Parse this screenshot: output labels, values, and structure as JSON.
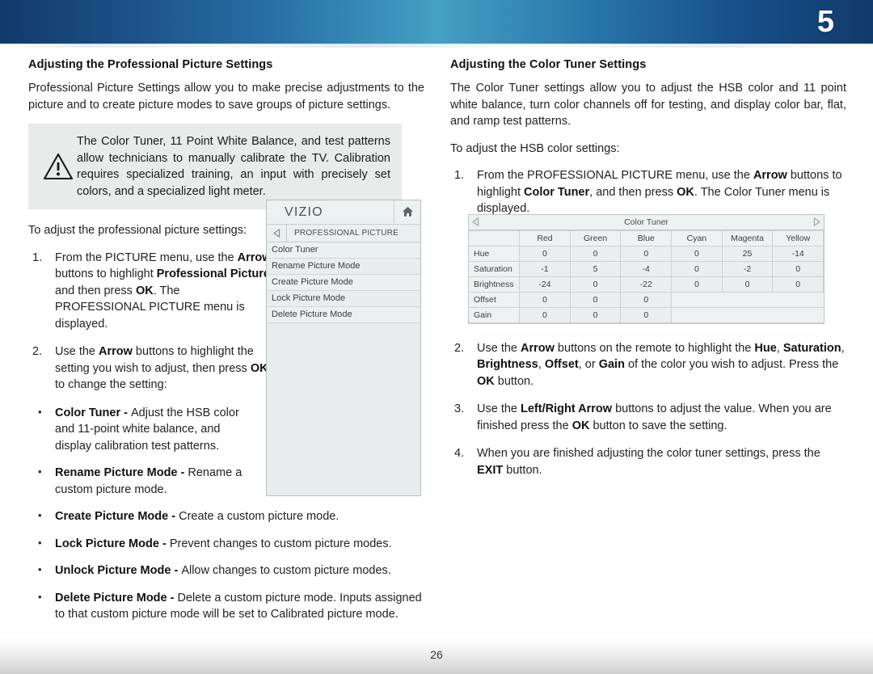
{
  "header": {
    "chapter_number": "5",
    "gradient_center": "#44a0c4",
    "gradient_edge": "#123a6b"
  },
  "footer": {
    "page_number": "26"
  },
  "left_column": {
    "section_title": "Adjusting the Professional Picture Settings",
    "intro": "Professional Picture Settings allow you to make precise adjustments to the picture and to create picture modes to save groups of picture settings.",
    "note": {
      "icon": "warning-triangle-icon",
      "text": "The Color Tuner, 11 Point White Balance, and test patterns allow technicians to manually calibrate the TV. Calibration requires specialized training, an input with precisely set colors, and a specialized light meter."
    },
    "lead_in": "To adjust the professional picture settings:",
    "steps": [
      {
        "number": "1.",
        "parts": [
          {
            "t": "From the PICTURE menu, use the ",
            "b": false
          },
          {
            "t": "Arrow",
            "b": true
          },
          {
            "t": " buttons to highlight ",
            "b": false
          },
          {
            "t": "Professional Picture",
            "b": true
          },
          {
            "t": ", and then press ",
            "b": false
          },
          {
            "t": "OK",
            "b": true
          },
          {
            "t": ". The PROFESSIONAL PICTURE menu is displayed.",
            "b": false
          }
        ]
      },
      {
        "number": "2.",
        "parts": [
          {
            "t": "Use the ",
            "b": false
          },
          {
            "t": "Arrow",
            "b": true
          },
          {
            "t": " buttons to highlight the setting you wish to adjust, then press ",
            "b": false
          },
          {
            "t": "OK",
            "b": true
          },
          {
            "t": " to change the setting:",
            "b": false
          }
        ]
      }
    ],
    "bullets": [
      {
        "narrow": true,
        "parts": [
          {
            "t": "Color Tuner - ",
            "b": true
          },
          {
            "t": "Adjust the HSB color and 11-point white balance, and display calibration test patterns.",
            "b": false
          }
        ]
      },
      {
        "narrow": true,
        "parts": [
          {
            "t": "Rename Picture Mode - ",
            "b": true
          },
          {
            "t": "Rename a custom picture mode.",
            "b": false
          }
        ]
      },
      {
        "narrow": false,
        "parts": [
          {
            "t": "Create Picture Mode - ",
            "b": true
          },
          {
            "t": "Create a custom picture mode.",
            "b": false
          }
        ]
      },
      {
        "narrow": false,
        "parts": [
          {
            "t": "Lock Picture Mode - ",
            "b": true
          },
          {
            "t": "Prevent changes to custom picture modes.",
            "b": false
          }
        ]
      },
      {
        "narrow": false,
        "parts": [
          {
            "t": "Unlock Picture Mode - ",
            "b": true
          },
          {
            "t": "Allow changes to custom picture modes.",
            "b": false
          }
        ]
      },
      {
        "narrow": false,
        "parts": [
          {
            "t": "Delete Picture Mode - ",
            "b": true
          },
          {
            "t": "Delete a custom picture mode. Inputs assigned to that custom picture mode will be set to Calibrated picture mode.",
            "b": false
          }
        ]
      }
    ]
  },
  "tv_menu": {
    "brand": "VIZIO",
    "home_icon": "home-icon",
    "back_icon": "back-arrow-icon",
    "breadcrumb": "PROFESSIONAL PICTURE",
    "items": [
      "Color Tuner",
      "Rename Picture Mode",
      "Create Picture Mode",
      "Lock Picture Mode",
      "Delete Picture Mode"
    ]
  },
  "right_column": {
    "section_title": "Adjusting the Color Tuner Settings",
    "intro": "The Color Tuner settings allow you to adjust the HSB color and 11 point white balance, turn color channels off for testing, and display color bar, flat, and ramp test patterns.",
    "lead_in": "To adjust the HSB color settings:",
    "steps": [
      {
        "number": "1.",
        "parts": [
          {
            "t": "From the PROFESSIONAL PICTURE menu, use the ",
            "b": false
          },
          {
            "t": "Arrow",
            "b": true
          },
          {
            "t": " buttons to highlight ",
            "b": false
          },
          {
            "t": "Color Tuner",
            "b": true
          },
          {
            "t": ", and then press ",
            "b": false
          },
          {
            "t": "OK",
            "b": true
          },
          {
            "t": ". The Color Tuner menu is displayed.",
            "b": false
          }
        ]
      },
      {
        "number": "2.",
        "parts": [
          {
            "t": "Use the ",
            "b": false
          },
          {
            "t": "Arrow",
            "b": true
          },
          {
            "t": " buttons on the remote to highlight the ",
            "b": false
          },
          {
            "t": "Hue",
            "b": true
          },
          {
            "t": ", ",
            "b": false
          },
          {
            "t": "Saturation",
            "b": true
          },
          {
            "t": ", ",
            "b": false
          },
          {
            "t": "Brightness",
            "b": true
          },
          {
            "t": ", ",
            "b": false
          },
          {
            "t": "Offset",
            "b": true
          },
          {
            "t": ", or ",
            "b": false
          },
          {
            "t": "Gain",
            "b": true
          },
          {
            "t": " of the color you wish to adjust. Press the ",
            "b": false
          },
          {
            "t": "OK",
            "b": true
          },
          {
            "t": "  button.",
            "b": false
          }
        ]
      },
      {
        "number": "3.",
        "parts": [
          {
            "t": "Use the ",
            "b": false
          },
          {
            "t": "Left/Right Arrow",
            "b": true
          },
          {
            "t": " buttons to adjust the value. When you are finished press the ",
            "b": false
          },
          {
            "t": "OK",
            "b": true
          },
          {
            "t": " button to save the setting.",
            "b": false
          }
        ]
      },
      {
        "number": "4.",
        "parts": [
          {
            "t": "When you are finished adjusting the color tuner settings, press the ",
            "b": false
          },
          {
            "t": "EXIT",
            "b": true
          },
          {
            "t": " button.",
            "b": false
          }
        ]
      }
    ]
  },
  "color_tuner_table": {
    "title": "Color Tuner",
    "left_arrow_icon": "left-arrow-icon",
    "right_arrow_icon": "right-arrow-icon",
    "columns": [
      "Red",
      "Green",
      "Blue",
      "Cyan",
      "Magenta",
      "Yellow"
    ],
    "rows": [
      {
        "label": "Hue",
        "values": [
          "0",
          "0",
          "0",
          "0",
          "25",
          "-14"
        ]
      },
      {
        "label": "Saturation",
        "values": [
          "-1",
          "5",
          "-4",
          "0",
          "-2",
          "0"
        ]
      },
      {
        "label": "Brightness",
        "values": [
          "-24",
          "0",
          "-22",
          "0",
          "0",
          "0"
        ]
      },
      {
        "label": "Offset",
        "values": [
          "0",
          "0",
          "0",
          null,
          null,
          null
        ]
      },
      {
        "label": "Gain",
        "values": [
          "0",
          "0",
          "0",
          null,
          null,
          null
        ]
      }
    ]
  }
}
